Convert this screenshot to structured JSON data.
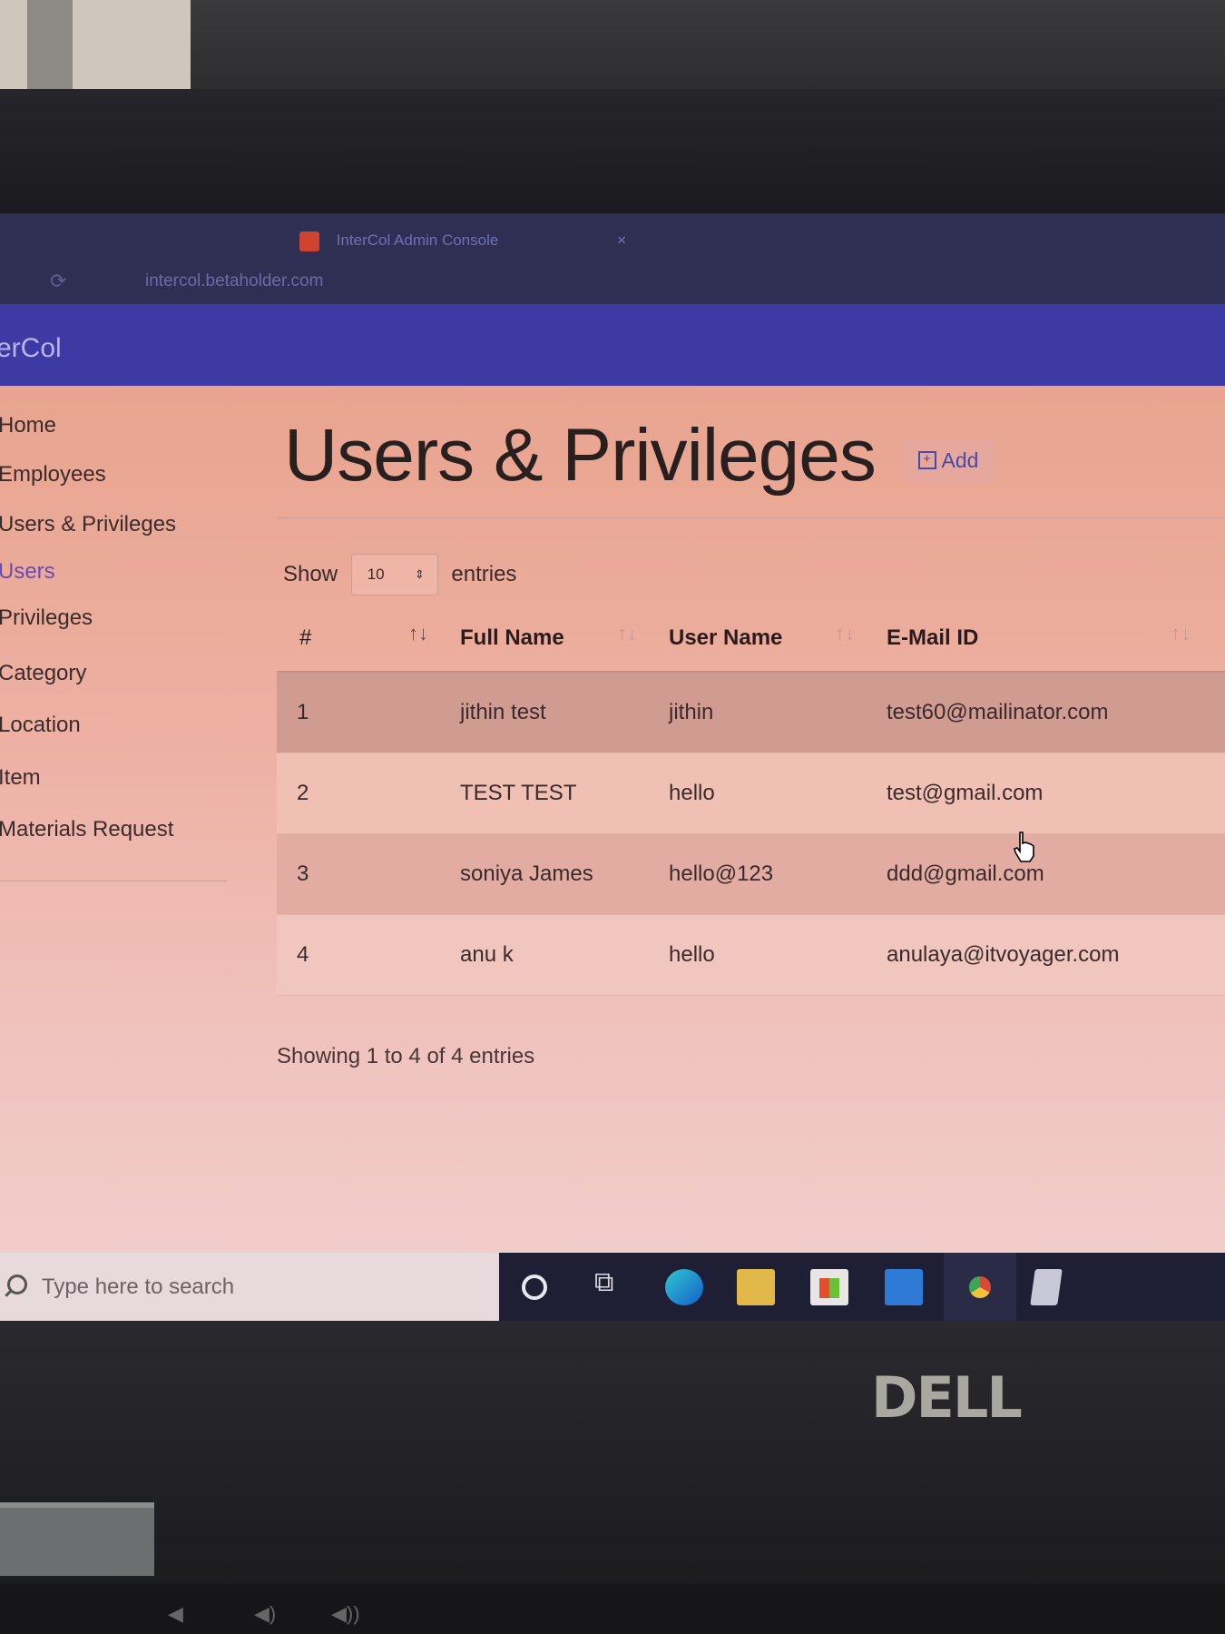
{
  "browser": {
    "tab_title": "InterCol Admin Console",
    "url": "intercol.betaholder.com"
  },
  "app": {
    "brand": "erCol"
  },
  "sidebar": {
    "items": [
      {
        "label": "Home"
      },
      {
        "label": "Employees"
      },
      {
        "label": "Users & Privileges"
      },
      {
        "label": "Users"
      },
      {
        "label": "Privileges"
      },
      {
        "label": "Category"
      },
      {
        "label": "Location"
      },
      {
        "label": "Item"
      },
      {
        "label": "Materials Request"
      }
    ]
  },
  "page": {
    "title": "Users & Privileges",
    "add_label": "Add",
    "show_label": "Show",
    "entries_label": "entries",
    "page_length": "10",
    "info": "Showing 1 to 4 of 4 entries"
  },
  "table": {
    "columns": [
      "#",
      "Full Name",
      "User Name",
      "E-Mail ID"
    ],
    "rows": [
      {
        "num": "1",
        "full_name": "jithin test",
        "user_name": "jithin",
        "email": "test60@mailinator.com"
      },
      {
        "num": "2",
        "full_name": "TEST TEST",
        "user_name": "hello",
        "email": "test@gmail.com"
      },
      {
        "num": "3",
        "full_name": "soniya James",
        "user_name": "hello@123",
        "email": "ddd@gmail.com"
      },
      {
        "num": "4",
        "full_name": "anu k",
        "user_name": "hello",
        "email": "anulaya@itvoyager.com"
      }
    ]
  },
  "taskbar": {
    "search_placeholder": "Type here to search"
  },
  "hardware": {
    "brand_logo": "DELL"
  },
  "colors": {
    "app_bar": "#3e3aa4",
    "accent": "#4a4aa6",
    "taskbar": "#1e1f35"
  },
  "icons": [
    "favicon",
    "reload-icon",
    "plus-icon",
    "arrows-icon",
    "sort-icon",
    "hand-cursor-icon",
    "search-icon",
    "cortana-icon",
    "task-view-icon",
    "edge-icon",
    "file-explorer-icon",
    "store-icon",
    "mail-icon",
    "chrome-icon"
  ]
}
